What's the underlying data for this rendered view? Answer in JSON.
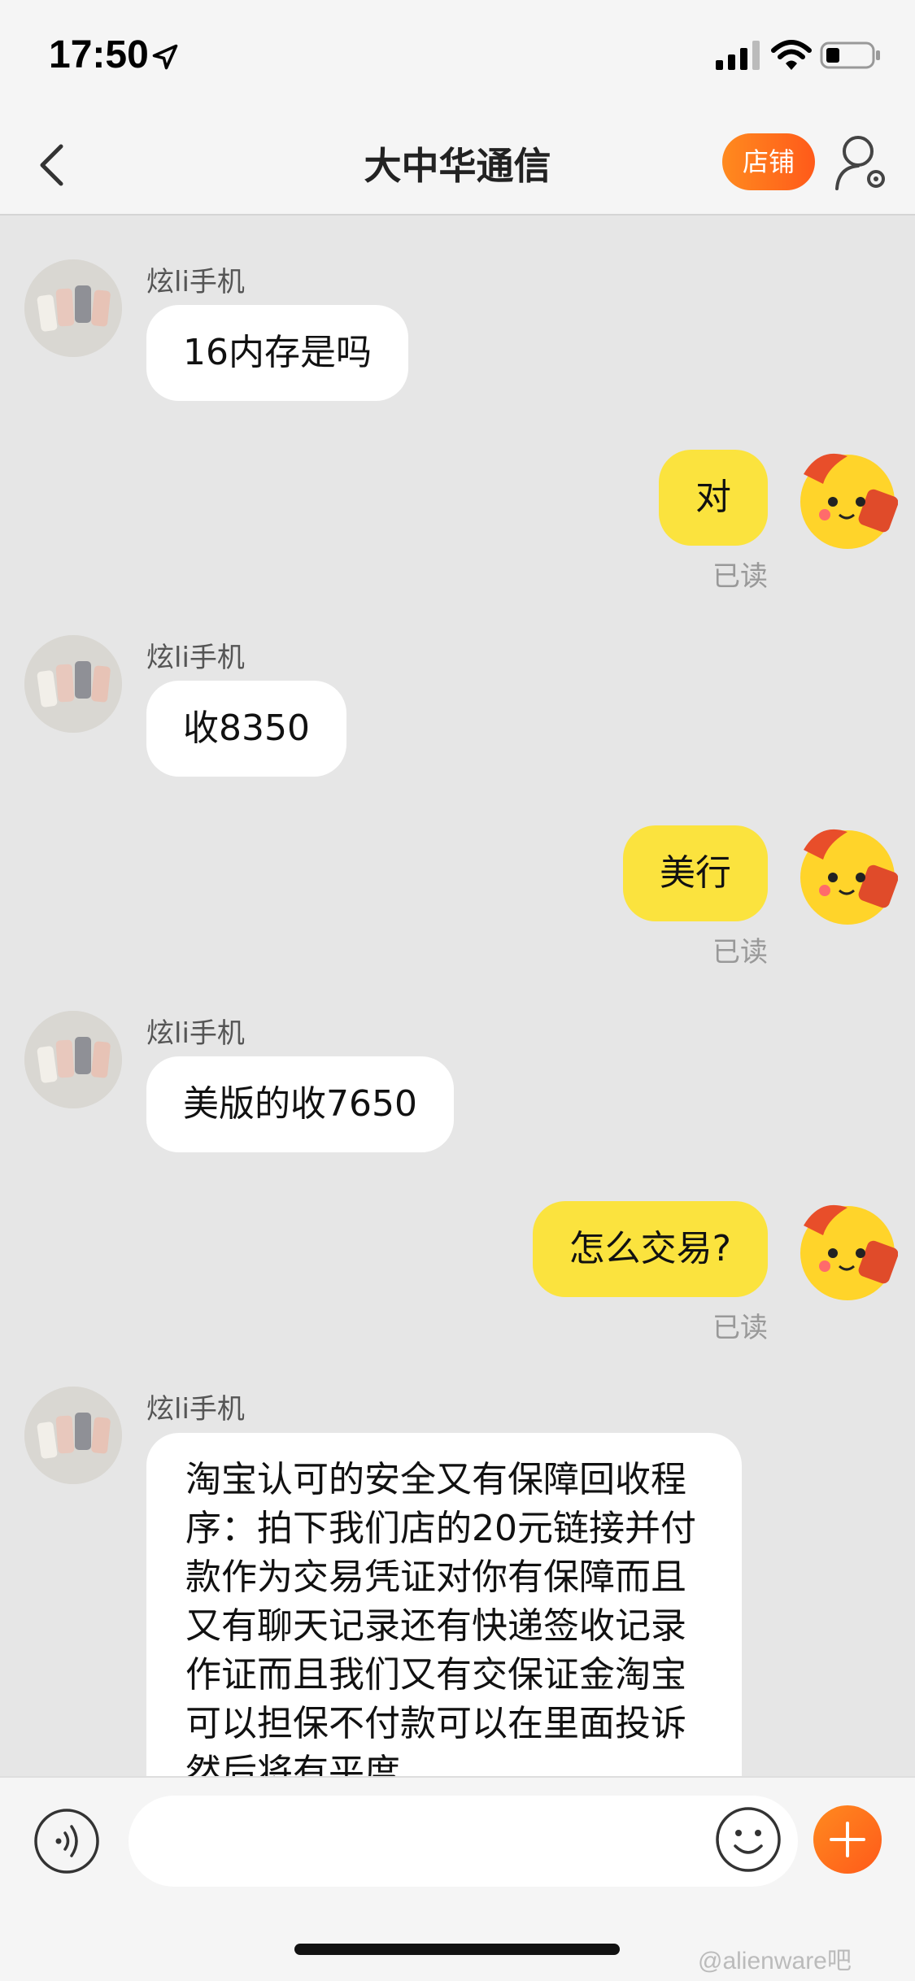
{
  "status_bar": {
    "time": "17:50"
  },
  "nav": {
    "title": "大中华通信",
    "shop_label": "店铺"
  },
  "messages": [
    {
      "direction": "in",
      "sender": "炫li手机",
      "text": "16内存是吗"
    },
    {
      "direction": "out",
      "text": "对",
      "status": "已读"
    },
    {
      "direction": "in",
      "sender": "炫li手机",
      "text": "收8350"
    },
    {
      "direction": "out",
      "text": "美行",
      "status": "已读"
    },
    {
      "direction": "in",
      "sender": "炫li手机",
      "text": "美版的收7650"
    },
    {
      "direction": "out",
      "text": "怎么交易?",
      "status": "已读"
    },
    {
      "direction": "in",
      "sender": "炫li手机",
      "text": "淘宝认可的安全又有保障回收程序：拍下我们店的20元链接并付款作为交易凭证对你有保障而且又有聊天记录还有快递签收记录作证而且我们又有交保证金淘宝可以担保不付款可以在里面投诉然后将有平度"
    }
  ],
  "input": {
    "placeholder": ""
  },
  "watermark": "@alienware吧",
  "colors": {
    "accent": "#ff6a1c",
    "outgoing_bubble": "#fbe33e",
    "incoming_bubble": "#ffffff",
    "background": "#e6e6e6"
  }
}
